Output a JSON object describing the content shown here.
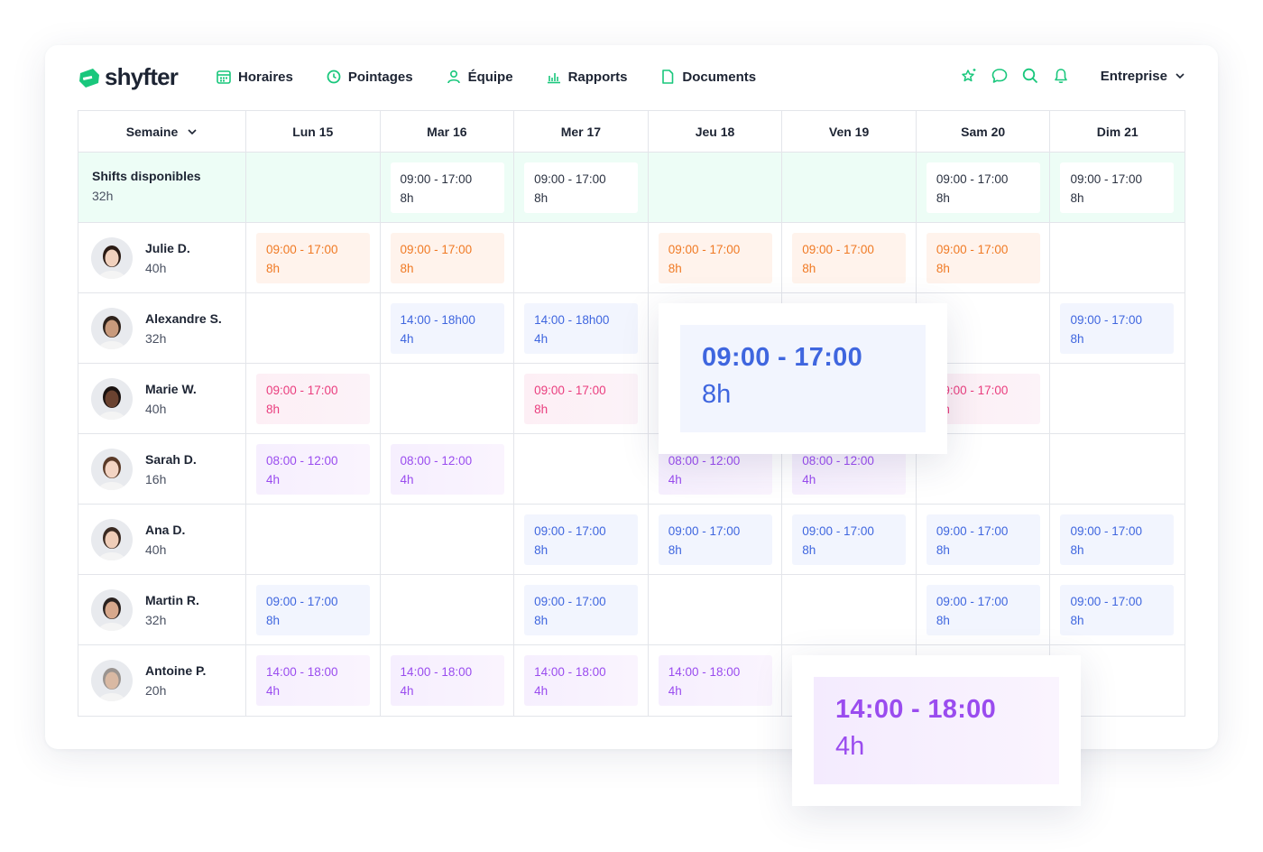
{
  "app": {
    "logo": "shyfter",
    "nav": [
      {
        "label": "Horaires",
        "icon": "calendar-icon"
      },
      {
        "label": "Pointages",
        "icon": "clock-icon"
      },
      {
        "label": "Équipe",
        "icon": "user-icon"
      },
      {
        "label": "Rapports",
        "icon": "chart-icon"
      },
      {
        "label": "Documents",
        "icon": "document-icon"
      }
    ],
    "company": "Entreprise",
    "accent": "#18c77c"
  },
  "schedule": {
    "week_selector": "Semaine",
    "days": [
      "Lun 15",
      "Mar 16",
      "Mer 17",
      "Jeu 18",
      "Ven 19",
      "Sam 20",
      "Dim 21"
    ],
    "available": {
      "title": "Shifts disponibles",
      "hours": "32h",
      "shifts": [
        null,
        [
          "09:00 - 17:00",
          "8h"
        ],
        [
          "09:00 - 17:00",
          "8h"
        ],
        null,
        null,
        [
          "09:00 - 17:00",
          "8h"
        ],
        [
          "09:00 - 17:00",
          "8h"
        ]
      ]
    },
    "employees": [
      {
        "name": "Julie D.",
        "hours": "40h",
        "color": "orange",
        "shifts": [
          [
            "09:00 - 17:00",
            "8h"
          ],
          [
            "09:00 - 17:00",
            "8h"
          ],
          null,
          [
            "09:00 - 17:00",
            "8h"
          ],
          [
            "09:00 - 17:00",
            "8h"
          ],
          [
            "09:00 - 17:00",
            "8h"
          ],
          null
        ]
      },
      {
        "name": "Alexandre S.",
        "hours": "32h",
        "color": "blue",
        "shifts": [
          null,
          [
            "14:00 - 18h00",
            "4h"
          ],
          [
            "14:00 - 18h00",
            "4h"
          ],
          null,
          null,
          null,
          [
            "09:00 - 17:00",
            "8h"
          ]
        ]
      },
      {
        "name": "Marie W.",
        "hours": "40h",
        "color": "pink",
        "shifts": [
          [
            "09:00 - 17:00",
            "8h"
          ],
          null,
          [
            "09:00 - 17:00",
            "8h"
          ],
          null,
          null,
          [
            "09:00 - 17:00",
            "8h"
          ],
          null
        ]
      },
      {
        "name": "Sarah D.",
        "hours": "16h",
        "color": "purple",
        "shifts": [
          [
            "08:00 - 12:00",
            "4h"
          ],
          [
            "08:00 - 12:00",
            "4h"
          ],
          null,
          [
            "08:00 - 12:00",
            "4h"
          ],
          [
            "08:00 - 12:00",
            "4h"
          ],
          null,
          null
        ]
      },
      {
        "name": "Ana D.",
        "hours": "40h",
        "color": "blue",
        "shifts": [
          null,
          null,
          [
            "09:00 - 17:00",
            "8h"
          ],
          [
            "09:00 - 17:00",
            "8h"
          ],
          [
            "09:00 - 17:00",
            "8h"
          ],
          [
            "09:00 - 17:00",
            "8h"
          ],
          [
            "09:00 - 17:00",
            "8h"
          ]
        ]
      },
      {
        "name": "Martin R.",
        "hours": "32h",
        "color": "blue",
        "shifts": [
          [
            "09:00 - 17:00",
            "8h"
          ],
          null,
          [
            "09:00 - 17:00",
            "8h"
          ],
          null,
          null,
          [
            "09:00 - 17:00",
            "8h"
          ],
          [
            "09:00 - 17:00",
            "8h"
          ]
        ]
      },
      {
        "name": "Antoine P.",
        "hours": "20h",
        "color": "purple",
        "shifts": [
          [
            "14:00 - 18:00",
            "4h"
          ],
          [
            "14:00 - 18:00",
            "4h"
          ],
          [
            "14:00 - 18:00",
            "4h"
          ],
          [
            "14:00 - 18:00",
            "4h"
          ],
          null,
          null,
          null
        ]
      }
    ]
  },
  "popups": [
    {
      "time": "09:00 - 17:00",
      "hours": "8h",
      "color": "blue"
    },
    {
      "time": "14:00 - 18:00",
      "hours": "4h",
      "color": "purple"
    }
  ]
}
